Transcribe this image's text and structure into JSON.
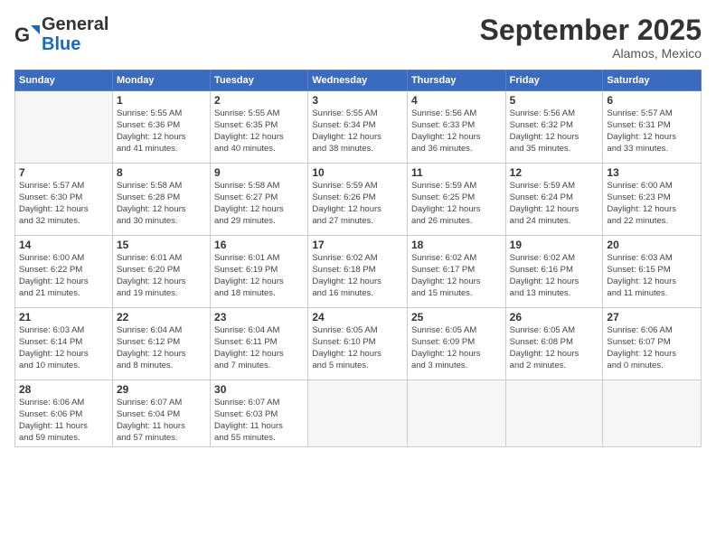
{
  "header": {
    "logo_general": "General",
    "logo_blue": "Blue",
    "month": "September 2025",
    "location": "Alamos, Mexico"
  },
  "days_of_week": [
    "Sunday",
    "Monday",
    "Tuesday",
    "Wednesday",
    "Thursday",
    "Friday",
    "Saturday"
  ],
  "weeks": [
    [
      {
        "day": "",
        "info": ""
      },
      {
        "day": "1",
        "info": "Sunrise: 5:55 AM\nSunset: 6:36 PM\nDaylight: 12 hours\nand 41 minutes."
      },
      {
        "day": "2",
        "info": "Sunrise: 5:55 AM\nSunset: 6:35 PM\nDaylight: 12 hours\nand 40 minutes."
      },
      {
        "day": "3",
        "info": "Sunrise: 5:55 AM\nSunset: 6:34 PM\nDaylight: 12 hours\nand 38 minutes."
      },
      {
        "day": "4",
        "info": "Sunrise: 5:56 AM\nSunset: 6:33 PM\nDaylight: 12 hours\nand 36 minutes."
      },
      {
        "day": "5",
        "info": "Sunrise: 5:56 AM\nSunset: 6:32 PM\nDaylight: 12 hours\nand 35 minutes."
      },
      {
        "day": "6",
        "info": "Sunrise: 5:57 AM\nSunset: 6:31 PM\nDaylight: 12 hours\nand 33 minutes."
      }
    ],
    [
      {
        "day": "7",
        "info": "Sunrise: 5:57 AM\nSunset: 6:30 PM\nDaylight: 12 hours\nand 32 minutes."
      },
      {
        "day": "8",
        "info": "Sunrise: 5:58 AM\nSunset: 6:28 PM\nDaylight: 12 hours\nand 30 minutes."
      },
      {
        "day": "9",
        "info": "Sunrise: 5:58 AM\nSunset: 6:27 PM\nDaylight: 12 hours\nand 29 minutes."
      },
      {
        "day": "10",
        "info": "Sunrise: 5:59 AM\nSunset: 6:26 PM\nDaylight: 12 hours\nand 27 minutes."
      },
      {
        "day": "11",
        "info": "Sunrise: 5:59 AM\nSunset: 6:25 PM\nDaylight: 12 hours\nand 26 minutes."
      },
      {
        "day": "12",
        "info": "Sunrise: 5:59 AM\nSunset: 6:24 PM\nDaylight: 12 hours\nand 24 minutes."
      },
      {
        "day": "13",
        "info": "Sunrise: 6:00 AM\nSunset: 6:23 PM\nDaylight: 12 hours\nand 22 minutes."
      }
    ],
    [
      {
        "day": "14",
        "info": "Sunrise: 6:00 AM\nSunset: 6:22 PM\nDaylight: 12 hours\nand 21 minutes."
      },
      {
        "day": "15",
        "info": "Sunrise: 6:01 AM\nSunset: 6:20 PM\nDaylight: 12 hours\nand 19 minutes."
      },
      {
        "day": "16",
        "info": "Sunrise: 6:01 AM\nSunset: 6:19 PM\nDaylight: 12 hours\nand 18 minutes."
      },
      {
        "day": "17",
        "info": "Sunrise: 6:02 AM\nSunset: 6:18 PM\nDaylight: 12 hours\nand 16 minutes."
      },
      {
        "day": "18",
        "info": "Sunrise: 6:02 AM\nSunset: 6:17 PM\nDaylight: 12 hours\nand 15 minutes."
      },
      {
        "day": "19",
        "info": "Sunrise: 6:02 AM\nSunset: 6:16 PM\nDaylight: 12 hours\nand 13 minutes."
      },
      {
        "day": "20",
        "info": "Sunrise: 6:03 AM\nSunset: 6:15 PM\nDaylight: 12 hours\nand 11 minutes."
      }
    ],
    [
      {
        "day": "21",
        "info": "Sunrise: 6:03 AM\nSunset: 6:14 PM\nDaylight: 12 hours\nand 10 minutes."
      },
      {
        "day": "22",
        "info": "Sunrise: 6:04 AM\nSunset: 6:12 PM\nDaylight: 12 hours\nand 8 minutes."
      },
      {
        "day": "23",
        "info": "Sunrise: 6:04 AM\nSunset: 6:11 PM\nDaylight: 12 hours\nand 7 minutes."
      },
      {
        "day": "24",
        "info": "Sunrise: 6:05 AM\nSunset: 6:10 PM\nDaylight: 12 hours\nand 5 minutes."
      },
      {
        "day": "25",
        "info": "Sunrise: 6:05 AM\nSunset: 6:09 PM\nDaylight: 12 hours\nand 3 minutes."
      },
      {
        "day": "26",
        "info": "Sunrise: 6:05 AM\nSunset: 6:08 PM\nDaylight: 12 hours\nand 2 minutes."
      },
      {
        "day": "27",
        "info": "Sunrise: 6:06 AM\nSunset: 6:07 PM\nDaylight: 12 hours\nand 0 minutes."
      }
    ],
    [
      {
        "day": "28",
        "info": "Sunrise: 6:06 AM\nSunset: 6:06 PM\nDaylight: 11 hours\nand 59 minutes."
      },
      {
        "day": "29",
        "info": "Sunrise: 6:07 AM\nSunset: 6:04 PM\nDaylight: 11 hours\nand 57 minutes."
      },
      {
        "day": "30",
        "info": "Sunrise: 6:07 AM\nSunset: 6:03 PM\nDaylight: 11 hours\nand 55 minutes."
      },
      {
        "day": "",
        "info": ""
      },
      {
        "day": "",
        "info": ""
      },
      {
        "day": "",
        "info": ""
      },
      {
        "day": "",
        "info": ""
      }
    ]
  ]
}
